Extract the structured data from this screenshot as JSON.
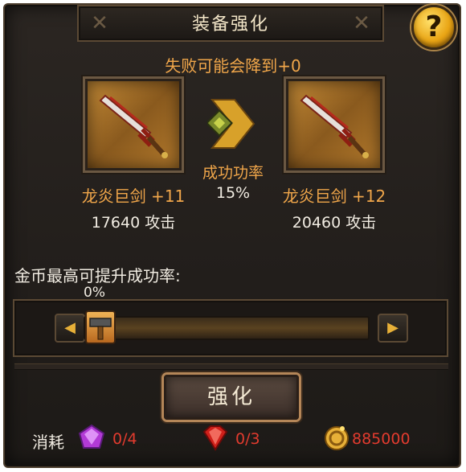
{
  "title": "装备强化",
  "help_label": "?",
  "warning": "失败可能会降到+0",
  "current_item": {
    "name": "龙炎巨剑 +11",
    "power": "17640 攻击"
  },
  "next_item": {
    "name": "龙炎巨剑 +12",
    "power": "20460 攻击"
  },
  "success": {
    "label": "成功功率",
    "value": "15%"
  },
  "gold_boost": {
    "label": "金币最高可提升成功率:",
    "percent": "0%",
    "level": 0
  },
  "enhance_button": "强化",
  "cost": {
    "label": "消耗",
    "purple_gem": "0/4",
    "red_gem": "0/3",
    "gold": "885000"
  },
  "colors": {
    "accent_orange": "#f0a64a",
    "cost_red": "#e23b2e",
    "gold": "#e7b038"
  }
}
